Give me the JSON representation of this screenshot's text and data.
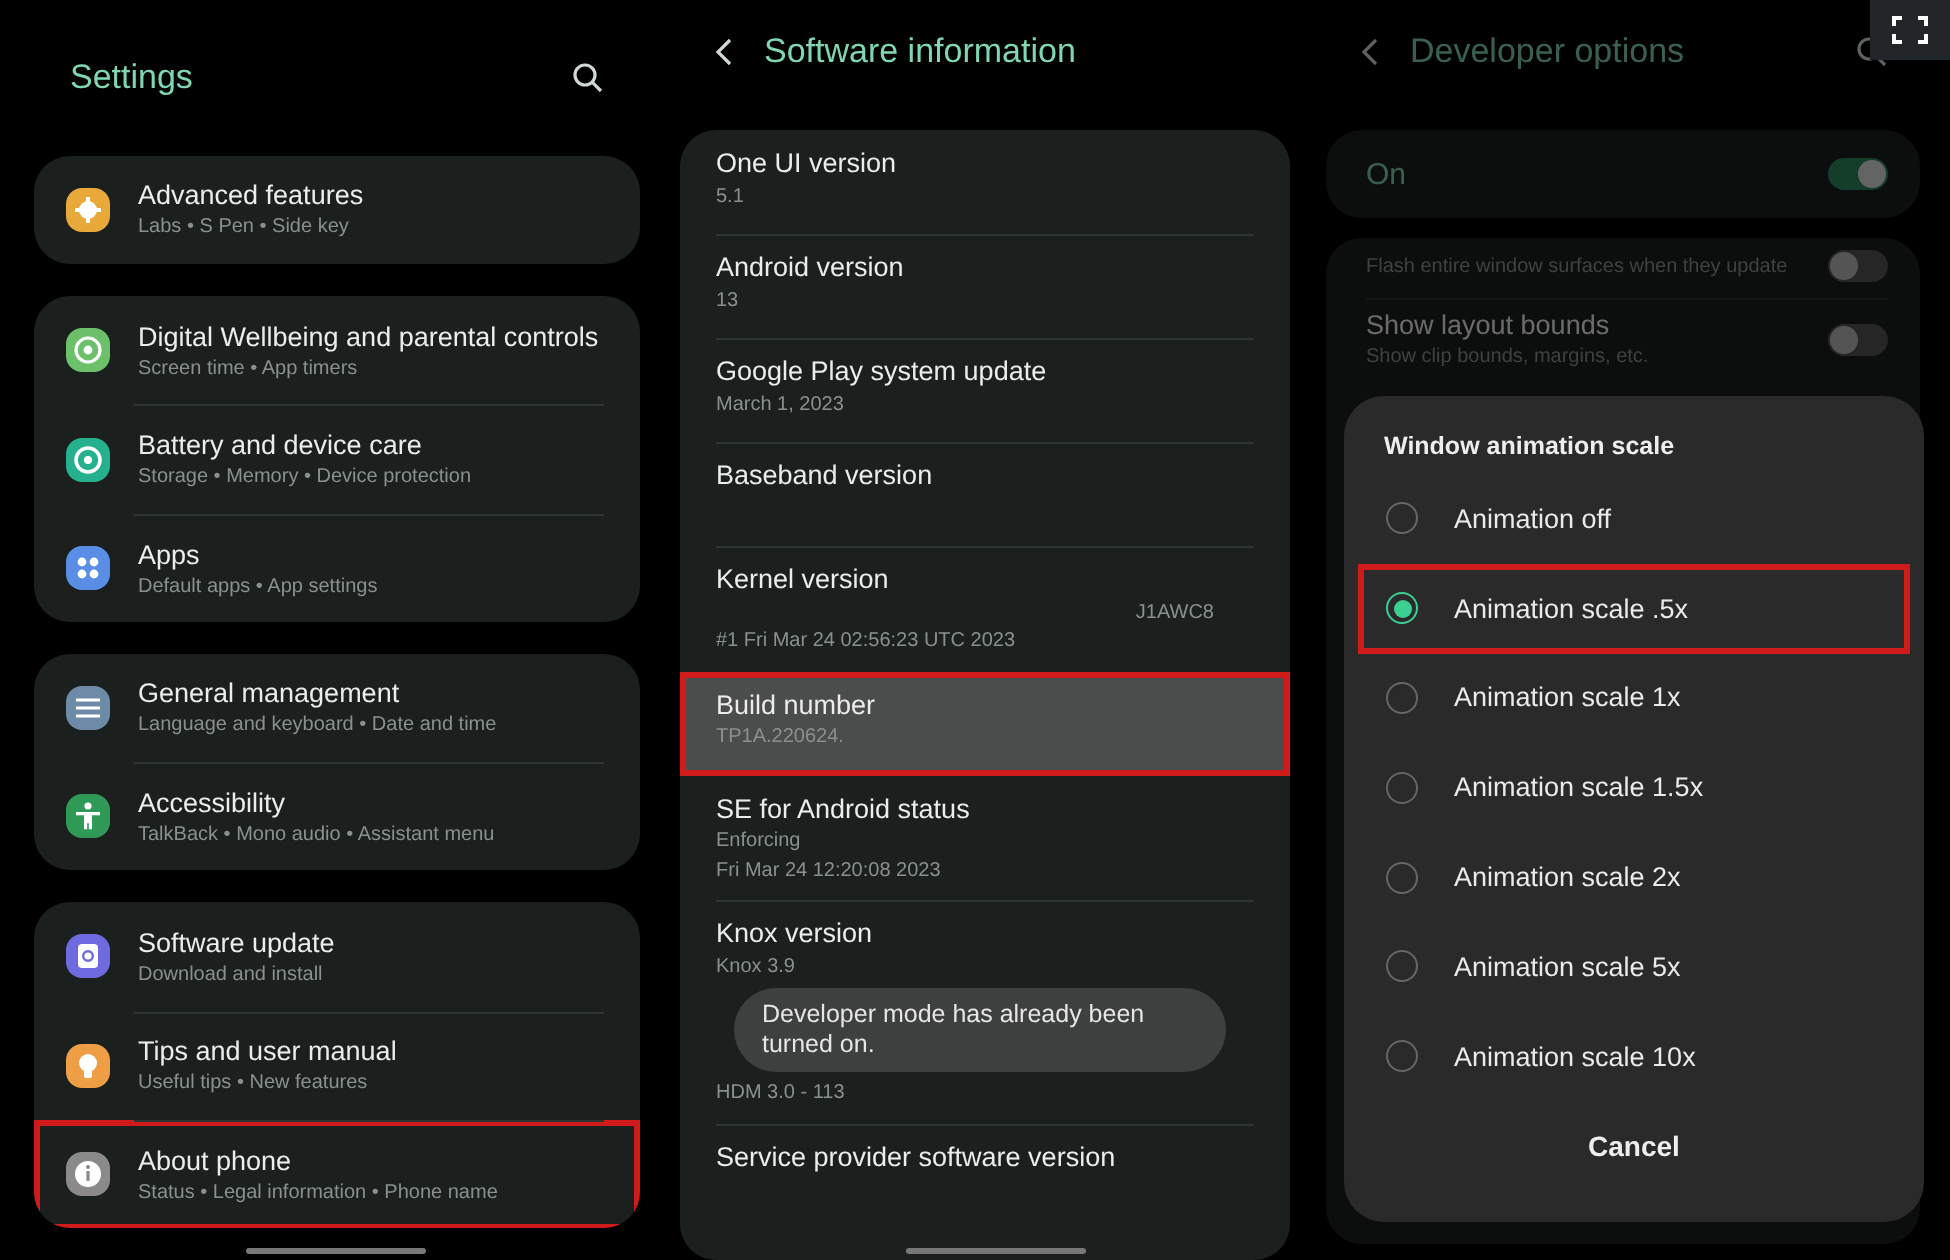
{
  "settings": {
    "title": "Settings",
    "groups": [
      {
        "items": [
          {
            "kind": "gear",
            "color": "#e8a93a",
            "title": "Advanced features",
            "subtitle": "Labs  •  S Pen  •  Side key",
            "highlighted": false
          }
        ]
      },
      {
        "items": [
          {
            "kind": "wellbeing",
            "color": "#6cc06a",
            "title": "Digital Wellbeing and parental controls",
            "subtitle": "Screen time  •  App timers",
            "highlighted": false
          },
          {
            "kind": "care",
            "color": "#25b08e",
            "title": "Battery and device care",
            "subtitle": "Storage  •  Memory  •  Device protection",
            "highlighted": false
          },
          {
            "kind": "apps",
            "color": "#5a8ee6",
            "title": "Apps",
            "subtitle": "Default apps  •  App settings",
            "highlighted": false
          }
        ]
      },
      {
        "items": [
          {
            "kind": "sliders",
            "color": "#6d8aa6",
            "title": "General management",
            "subtitle": "Language and keyboard  •  Date and time",
            "highlighted": false
          },
          {
            "kind": "person",
            "color": "#2f9a57",
            "title": "Accessibility",
            "subtitle": "TalkBack  •  Mono audio  •  Assistant menu",
            "highlighted": false
          }
        ]
      },
      {
        "items": [
          {
            "kind": "update",
            "color": "#6e6ae0",
            "title": "Software update",
            "subtitle": "Download and install",
            "highlighted": false
          },
          {
            "kind": "bulb",
            "color": "#ee9e45",
            "title": "Tips and user manual",
            "subtitle": "Useful tips  •  New features",
            "highlighted": false
          },
          {
            "kind": "info",
            "color": "#8a8a8a",
            "title": "About phone",
            "subtitle": "Status  •  Legal information  •  Phone name",
            "highlighted": true
          }
        ]
      }
    ]
  },
  "software_information": {
    "title": "Software information",
    "items": [
      {
        "title": "One UI version",
        "lines": [
          "5.1"
        ],
        "highlighted": false
      },
      {
        "title": "Android version",
        "lines": [
          "13"
        ],
        "highlighted": false
      },
      {
        "title": "Google Play system update",
        "lines": [
          "March 1, 2023"
        ],
        "highlighted": false
      },
      {
        "title": "Baseband version",
        "highlighted": false
      },
      {
        "title": "Kernel version",
        "side": "J1AWC8",
        "lines": [
          "#1 Fri Mar 24 02:56:23 UTC 2023"
        ],
        "highlighted": false
      },
      {
        "title": "Build number",
        "lines": [
          "TP1A.220624."
        ],
        "highlighted": true
      },
      {
        "title": "SE for Android status",
        "lines": [
          "Enforcing",
          "Fri Mar 24 12:20:08 2023"
        ],
        "highlighted": false
      },
      {
        "title": "Knox version",
        "lines": [
          "Knox 3.9",
          "HDM 3.0 - 113"
        ],
        "toast": "Developer mode has already been turned on.",
        "highlighted": false
      },
      {
        "title": "Service provider software version",
        "highlighted": false
      }
    ]
  },
  "developer_options": {
    "title": "Developer options",
    "master": {
      "label": "On",
      "on": true
    },
    "rows": [
      {
        "subtitle": "Flash entire window surfaces when they update",
        "on": false
      },
      {
        "title": "Show layout bounds",
        "subtitle": "Show clip bounds, margins, etc.",
        "on": false
      }
    ],
    "dialog": {
      "title": "Window animation scale",
      "options": [
        {
          "label": "Animation off",
          "selected": false,
          "highlighted": false
        },
        {
          "label": "Animation scale .5x",
          "selected": true,
          "highlighted": true
        },
        {
          "label": "Animation scale 1x",
          "selected": false,
          "highlighted": false
        },
        {
          "label": "Animation scale 1.5x",
          "selected": false,
          "highlighted": false
        },
        {
          "label": "Animation scale 2x",
          "selected": false,
          "highlighted": false
        },
        {
          "label": "Animation scale 5x",
          "selected": false,
          "highlighted": false
        },
        {
          "label": "Animation scale 10x",
          "selected": false,
          "highlighted": false
        }
      ],
      "cancel": "Cancel"
    }
  }
}
